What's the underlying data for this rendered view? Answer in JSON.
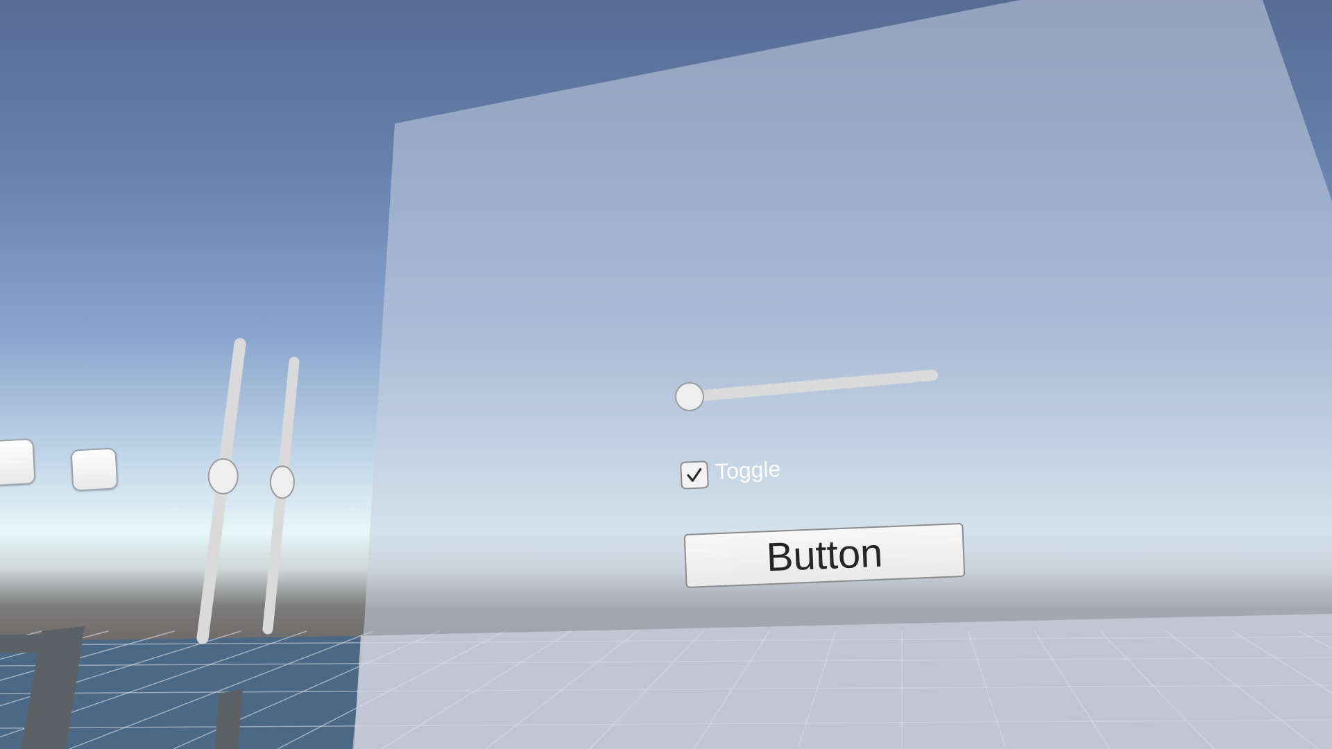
{
  "scene": {
    "colors": {
      "panel": "#c7cfe0",
      "slider_track": "#dadada",
      "slider_handle": "#eeeeee",
      "floor": "#b9bdc3",
      "floor_dark": "#4b6884",
      "grid_line": "#e8ebee",
      "pillar": "#5c6166"
    }
  },
  "left_controls": {
    "buttons": [
      {
        "label": ""
      },
      {
        "label": ""
      }
    ],
    "sliders": [
      {
        "orientation": "vertical",
        "value": 0.55
      },
      {
        "orientation": "vertical",
        "value": 0.55
      }
    ]
  },
  "canvas_panel": {
    "slider": {
      "orientation": "horizontal",
      "value": 0.0
    },
    "toggle": {
      "label": "Toggle",
      "checked": true,
      "check_icon": "checkmark-icon"
    },
    "button": {
      "label": "Button"
    }
  }
}
